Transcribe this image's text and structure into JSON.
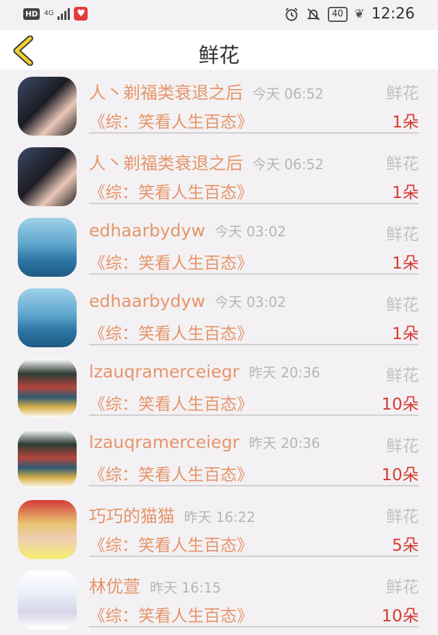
{
  "statusbar": {
    "hd": "HD",
    "network": "4G",
    "battery": "40",
    "time": "12:26"
  },
  "navbar": {
    "title": "鲜花"
  },
  "items": [
    {
      "name": "人丶剃福类衰退之后",
      "time": "今天 06:52",
      "gift_type": "鲜花",
      "work": "《综：笑看人生百态》",
      "count": "1朵"
    },
    {
      "name": "人丶剃福类衰退之后",
      "time": "今天 06:52",
      "gift_type": "鲜花",
      "work": "《综：笑看人生百态》",
      "count": "1朵"
    },
    {
      "name": "edhaarbydyw",
      "time": "今天 03:02",
      "gift_type": "鲜花",
      "work": "《综：笑看人生百态》",
      "count": "1朵"
    },
    {
      "name": "edhaarbydyw",
      "time": "今天 03:02",
      "gift_type": "鲜花",
      "work": "《综：笑看人生百态》",
      "count": "1朵"
    },
    {
      "name": "lzauqramerceiegr",
      "time": "昨天 20:36",
      "gift_type": "鲜花",
      "work": "《综：笑看人生百态》",
      "count": "10朵"
    },
    {
      "name": "lzauqramerceiegr",
      "time": "昨天 20:36",
      "gift_type": "鲜花",
      "work": "《综：笑看人生百态》",
      "count": "10朵"
    },
    {
      "name": "巧巧的猫猫",
      "time": "昨天 16:22",
      "gift_type": "鲜花",
      "work": "《综：笑看人生百态》",
      "count": "5朵"
    },
    {
      "name": "林优萱",
      "time": "昨天 16:15",
      "gift_type": "鲜花",
      "work": "《综：笑看人生百态》",
      "count": "10朵"
    }
  ]
}
